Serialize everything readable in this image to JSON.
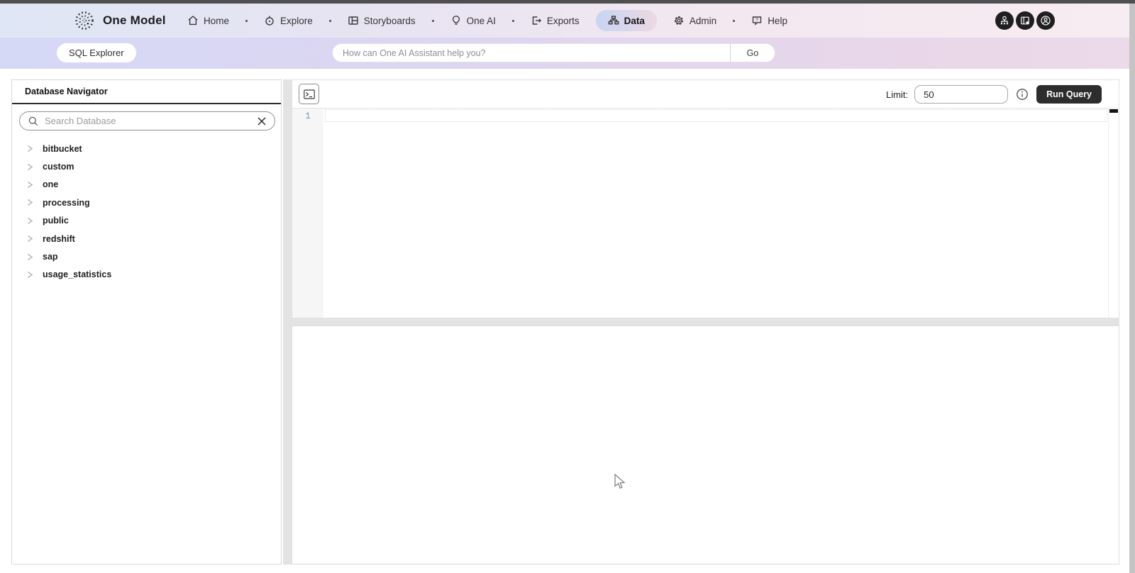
{
  "nav": {
    "brand": "One Model",
    "items": [
      {
        "label": "Home",
        "icon": "home-icon",
        "active": false
      },
      {
        "label": "Explore",
        "icon": "explore-icon",
        "active": false
      },
      {
        "label": "Storyboards",
        "icon": "storyboards-icon",
        "active": false
      },
      {
        "label": "One AI",
        "icon": "one-ai-icon",
        "active": false
      },
      {
        "label": "Exports",
        "icon": "exports-icon",
        "active": false
      },
      {
        "label": "Data",
        "icon": "data-icon",
        "active": true
      },
      {
        "label": "Admin",
        "icon": "admin-icon",
        "active": false
      },
      {
        "label": "Help",
        "icon": "help-icon",
        "active": false
      }
    ],
    "right_buttons": [
      {
        "icon": "org-share-icon"
      },
      {
        "icon": "storyboard-star-icon"
      },
      {
        "icon": "account-icon"
      }
    ]
  },
  "assistant_bar": {
    "app_pill": "SQL Explorer",
    "input_placeholder": "How can One AI Assistant help you?",
    "go_label": "Go"
  },
  "sidebar": {
    "title": "Database Navigator",
    "search_placeholder": "Search Database",
    "items": [
      "bitbucket",
      "custom",
      "one",
      "processing",
      "public",
      "redshift",
      "sap",
      "usage_statistics"
    ]
  },
  "editor": {
    "limit_label": "Limit:",
    "limit_value": "50",
    "run_query_label": "Run Query",
    "line_number": "1"
  },
  "colors": {
    "nav_gradient_start": "#dfe6f5",
    "nav_gradient_end": "#f6ecf1",
    "assistant_gradient_start": "#d5d9f6",
    "assistant_gradient_end": "#ecd9e9",
    "data_pill_start": "#c7d5f4",
    "data_pill_end": "#edd8e2",
    "run_button_bg": "#2d2d2d",
    "line_number_color": "#7497bd",
    "top_strip": "#4f4f4f"
  }
}
